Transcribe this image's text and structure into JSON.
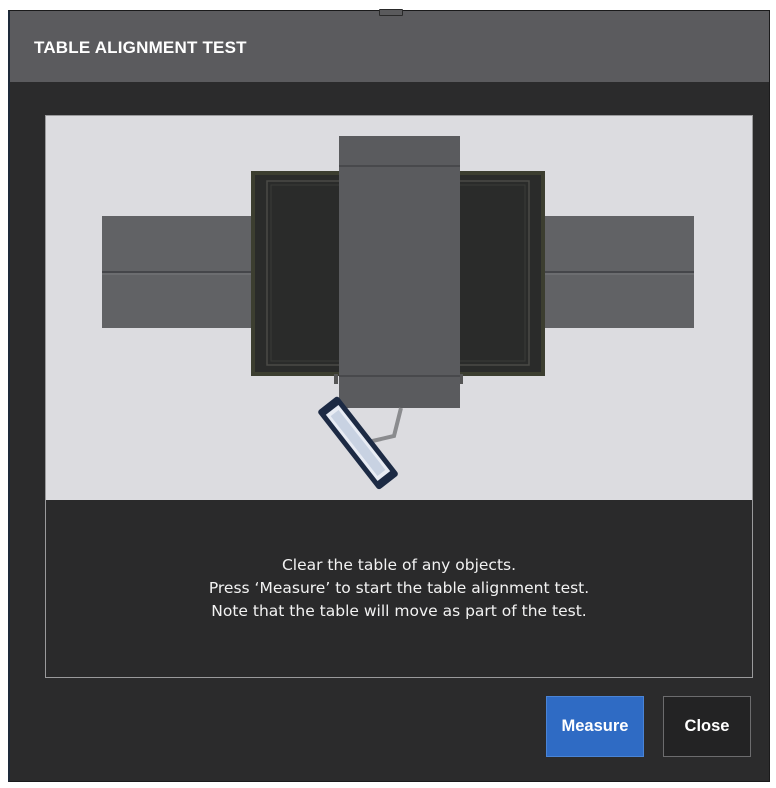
{
  "dialog": {
    "title": "TABLE ALIGNMENT TEST"
  },
  "illustration": {
    "description_icon": "table-alignment-diagram-icon",
    "colors": {
      "background": "#dcdce0",
      "table_top": "#2e2f2e",
      "table_frame": "#3c3e30",
      "gantry": "#5a5b5e",
      "arms": "#616265",
      "sensor_screen": "#e8ecf4"
    }
  },
  "message": {
    "lines": [
      "Clear the table of any objects.",
      "Press ‘Measure’ to start the table alignment test.",
      "Note that the table will move as part of the test."
    ]
  },
  "buttons": {
    "measure_label": "Measure",
    "close_label": "Close"
  },
  "colors": {
    "dialog_background": "#2b2b2c",
    "title_bar": "#5b5b5e",
    "accent_button": "#2f6bc4",
    "title_text": "#ffffff"
  }
}
